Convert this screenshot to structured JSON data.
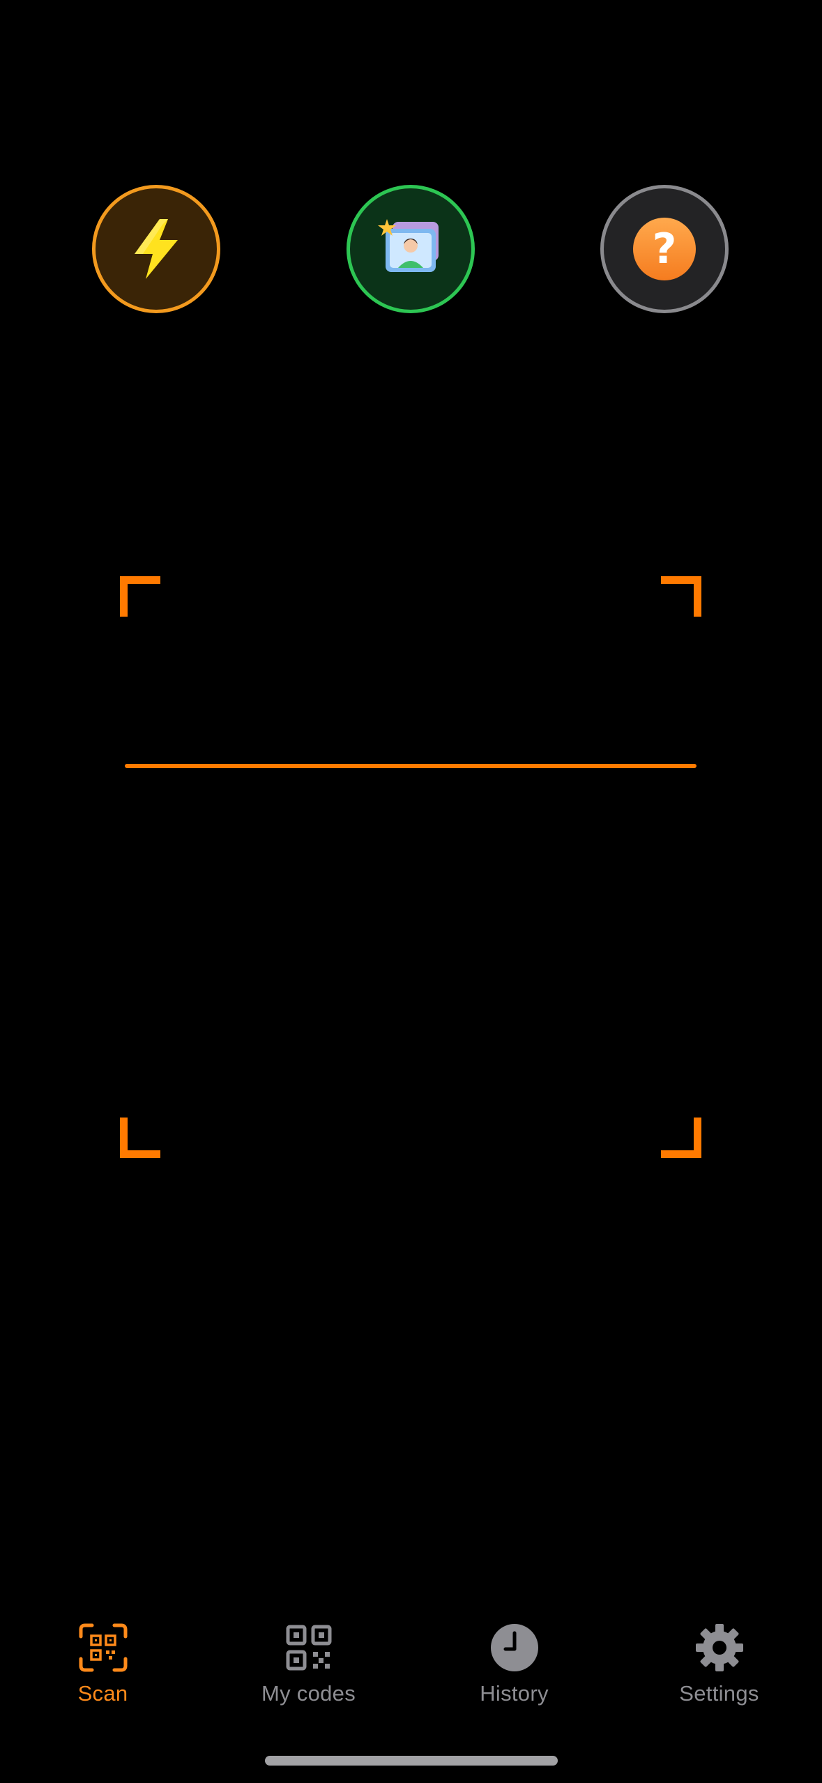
{
  "top_controls": {
    "flash_icon": "lightning-bolt-icon",
    "gallery_icon": "photo-gallery-icon",
    "help_icon": "question-mark-icon",
    "help_glyph": "?"
  },
  "scanner": {
    "frame_color": "#FF7A00",
    "line_color": "#FF7A00"
  },
  "tab_bar": {
    "active_tab": "Scan",
    "tabs": [
      {
        "label": "Scan",
        "icon": "qr-scan-icon"
      },
      {
        "label": "My codes",
        "icon": "qr-code-icon"
      },
      {
        "label": "History",
        "icon": "clock-icon"
      },
      {
        "label": "Settings",
        "icon": "gear-icon"
      }
    ]
  },
  "colors": {
    "accent": "#FF7A00",
    "inactive": "#8E8E93",
    "flash_ring": "#F39A1E",
    "gallery_ring": "#2DC653",
    "help_ring": "#8A8A8E"
  }
}
